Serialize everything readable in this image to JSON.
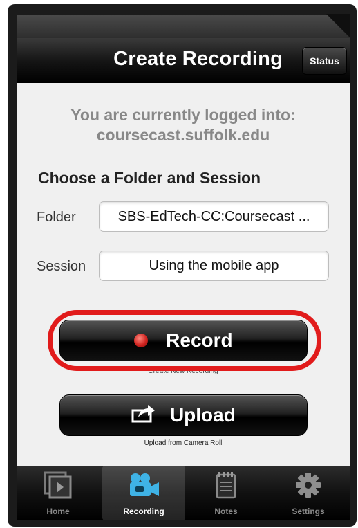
{
  "nav": {
    "title": "Create Recording",
    "status_button": "Status"
  },
  "login": {
    "line1": "You are currently logged into:",
    "line2": "coursecast.suffolk.edu"
  },
  "section_title": "Choose a Folder and Session",
  "fields": {
    "folder_label": "Folder",
    "folder_value": "SBS-EdTech-CC:Coursecast ...",
    "session_label": "Session",
    "session_value": "Using the mobile app"
  },
  "actions": {
    "record_label": "Record",
    "record_caption": "Create New Recording",
    "upload_label": "Upload",
    "upload_caption": "Upload from Camera Roll"
  },
  "tabs": [
    {
      "label": "Home",
      "icon": "home-icon"
    },
    {
      "label": "Recording",
      "icon": "camera-icon"
    },
    {
      "label": "Notes",
      "icon": "notepad-icon"
    },
    {
      "label": "Settings",
      "icon": "gear-icon"
    }
  ],
  "colors": {
    "highlight": "#e11b1b",
    "record_dot": "#d0231f",
    "active_tab_icon": "#3fb3e6"
  }
}
